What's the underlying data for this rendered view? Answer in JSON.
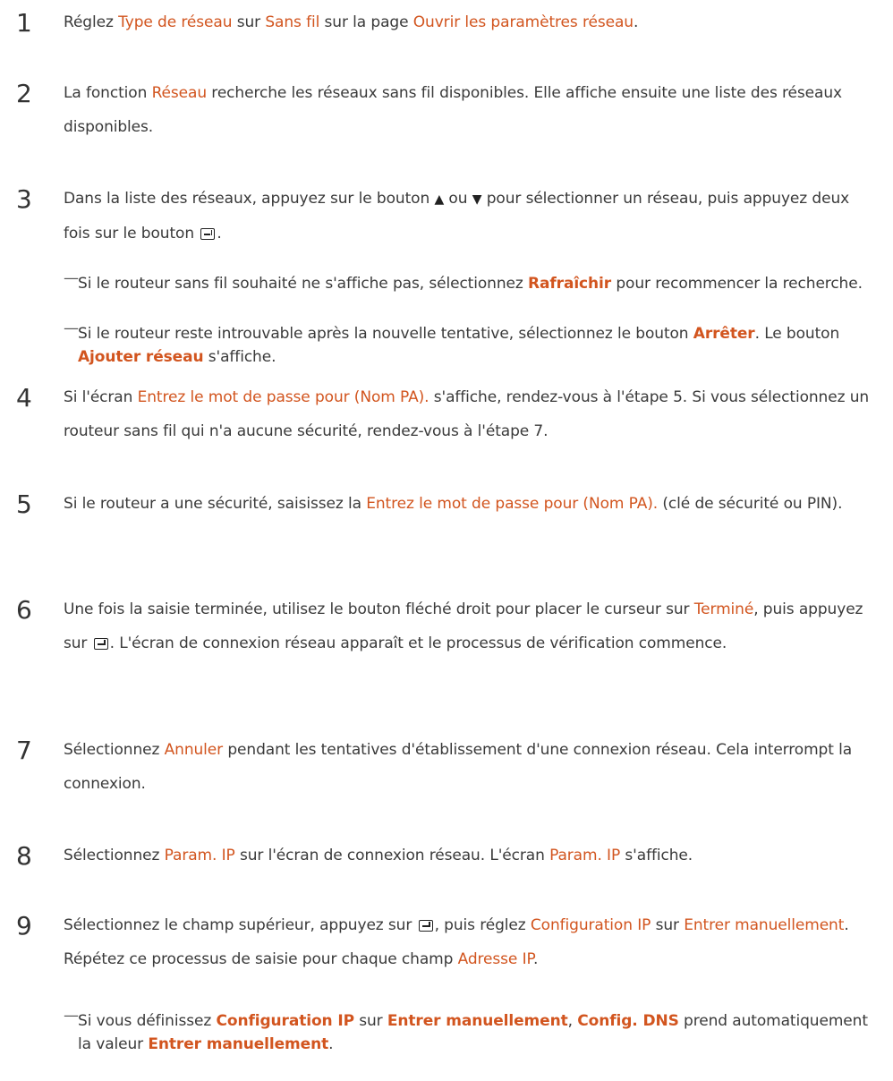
{
  "steps": [
    {
      "number": "1",
      "parts": [
        "Réglez ",
        "Type de réseau",
        " sur ",
        "Sans fil",
        " sur la page ",
        "Ouvrir les paramètres réseau",
        "."
      ]
    },
    {
      "number": "2",
      "parts": [
        "La fonction ",
        "Réseau",
        " recherche les réseaux sans fil disponibles. Elle affiche ensuite une liste des réseaux disponibles."
      ]
    },
    {
      "number": "3",
      "parts": [
        "Dans la liste des réseaux, appuyez sur le bouton ",
        "ou",
        "pour sélectionner un réseau, puis appuyez deux fois sur le bouton",
        "."
      ]
    },
    {
      "number": "4",
      "parts": [
        "Si l'écran ",
        "Entrez le mot de passe pour (Nom PA).",
        " s'affiche, rendez-vous à l'étape 5. Si vous sélectionnez un routeur sans fil qui n'a aucune sécurité, rendez-vous à l'étape 7."
      ]
    },
    {
      "number": "5",
      "parts": [
        "Si le routeur a une sécurité, saisissez la ",
        "Entrez le mot de passe pour (Nom PA).",
        " (clé de sécurité ou PIN)."
      ]
    },
    {
      "number": "6",
      "parts": [
        "Une fois la saisie terminée, utilisez le bouton fléché droit pour placer le curseur sur ",
        "Terminé",
        ", puis appuyez sur ",
        ". L'écran de connexion réseau apparaît et le processus de vérification commence."
      ]
    },
    {
      "number": "7",
      "parts": [
        "Sélectionnez ",
        "Annuler",
        " pendant les tentatives d'établissement d'une connexion réseau. Cela interrompt la connexion."
      ]
    },
    {
      "number": "8",
      "parts": [
        "Sélectionnez ",
        "Param. IP",
        " sur l'écran de connexion réseau. L'écran ",
        "Param. IP",
        " s'affiche."
      ]
    },
    {
      "number": "9",
      "parts": [
        "Sélectionnez le champ supérieur, appuyez sur ",
        ", puis réglez ",
        "Configuration IP",
        " sur ",
        "Entrer manuellement",
        ". Répétez ce processus de saisie pour chaque champ ",
        "Adresse IP",
        "."
      ]
    }
  ],
  "notes": [
    {
      "parts": [
        "Si le routeur sans fil souhaité ne s'affiche pas, sélectionnez ",
        "Rafraîchir",
        " pour recommencer la recherche."
      ]
    },
    {
      "parts": [
        "Si le routeur reste introuvable après la nouvelle tentative, sélectionnez le bouton ",
        "Arrêter",
        ". Le bouton ",
        "Ajouter réseau",
        " s'affiche."
      ]
    },
    {
      "parts": [
        "Si vous définissez ",
        "Configuration IP",
        " sur ",
        "Entrer manuellement",
        ", ",
        "Config. DNS",
        " prend automatiquement la valeur ",
        "Entrer manuellement",
        "."
      ]
    }
  ],
  "symbols": {
    "up": "▲",
    "down": "▼",
    "note_dash": "—"
  },
  "icons": [
    "up-triangle-icon",
    "down-triangle-icon",
    "enter-icon"
  ],
  "colors": {
    "highlight": "#d2551f",
    "text": "#3a3a3a"
  }
}
